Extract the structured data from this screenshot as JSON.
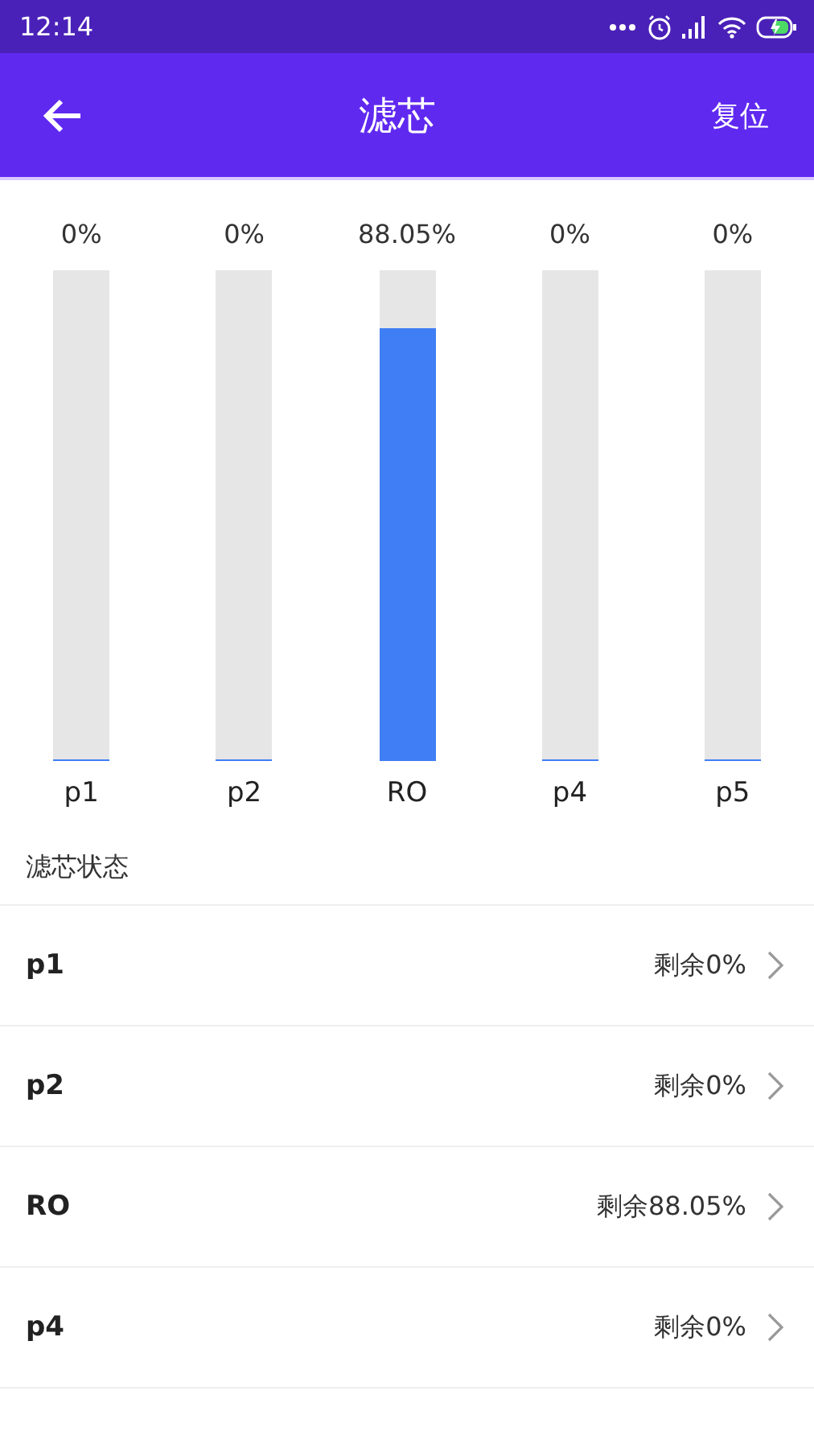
{
  "status_bar": {
    "time": "12:14"
  },
  "app_bar": {
    "title": "滤芯",
    "action": "复位"
  },
  "chart": {
    "filters": [
      {
        "name": "p1",
        "percent": "0%",
        "level": 0
      },
      {
        "name": "p2",
        "percent": "0%",
        "level": 0
      },
      {
        "name": "RO",
        "percent": "88.05%",
        "level": 0.8805
      },
      {
        "name": "p4",
        "percent": "0%",
        "level": 0
      },
      {
        "name": "p5",
        "percent": "0%",
        "level": 0
      }
    ]
  },
  "section_title": "滤芯状态",
  "rows": [
    {
      "name": "p1",
      "remaining": "剩余0%"
    },
    {
      "name": "p2",
      "remaining": "剩余0%"
    },
    {
      "name": "RO",
      "remaining": "剩余88.05%"
    },
    {
      "name": "p4",
      "remaining": "剩余0%"
    }
  ]
}
